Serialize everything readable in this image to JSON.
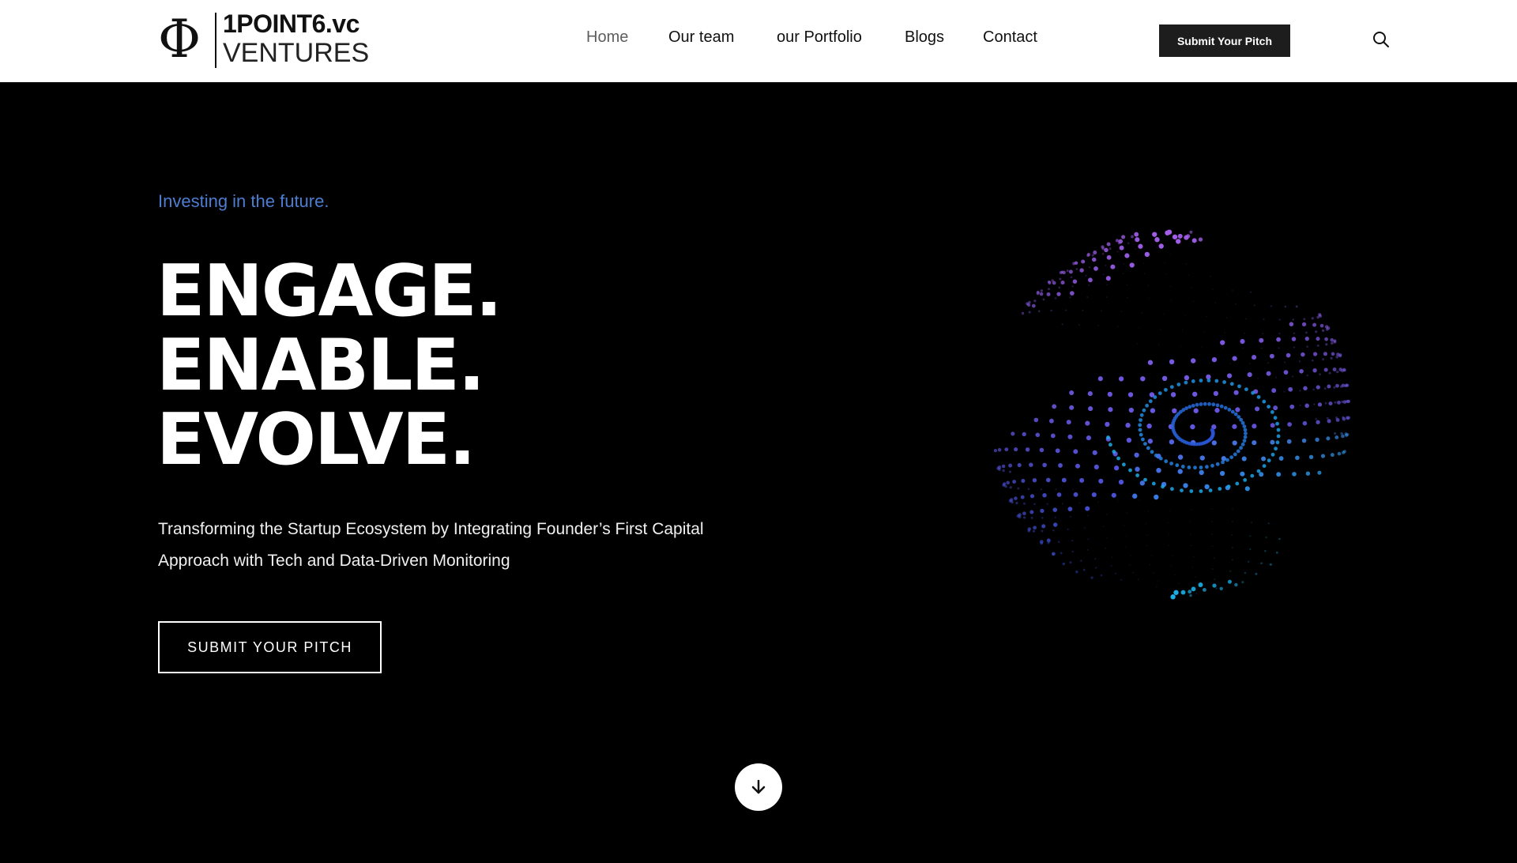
{
  "brand": {
    "symbol": "Φ",
    "name_top": "1POINT6.vc",
    "name_bottom": "VENTURES"
  },
  "nav": {
    "items": [
      {
        "label": "Home",
        "active": true
      },
      {
        "label": "Our team",
        "active": false
      },
      {
        "label": "our Portfolio",
        "active": false
      },
      {
        "label": "Blogs",
        "active": false
      },
      {
        "label": "Contact",
        "active": false
      }
    ],
    "cta_label": "Submit Your Pitch",
    "search_icon": "search-icon"
  },
  "hero": {
    "tagline": "Investing in the future.",
    "headline": [
      "ENGAGE.",
      "ENABLE.",
      "EVOLVE."
    ],
    "description": "Transforming the Startup Ecosystem by Integrating Founder’s First Capital Approach with Tech and Data-Driven Monitoring",
    "cta_label": "SUBMIT YOUR PITCH",
    "scroll_icon": "arrow-down-icon"
  },
  "colors": {
    "tagline": "#4d7dd0",
    "hero_bg": "#000000",
    "header_bg": "#ffffff",
    "cta_bg": "#1d1d1d",
    "sphere_purple": "#a45ee8",
    "sphere_blue": "#2a4fd6",
    "sphere_cyan": "#1ab0e8"
  }
}
